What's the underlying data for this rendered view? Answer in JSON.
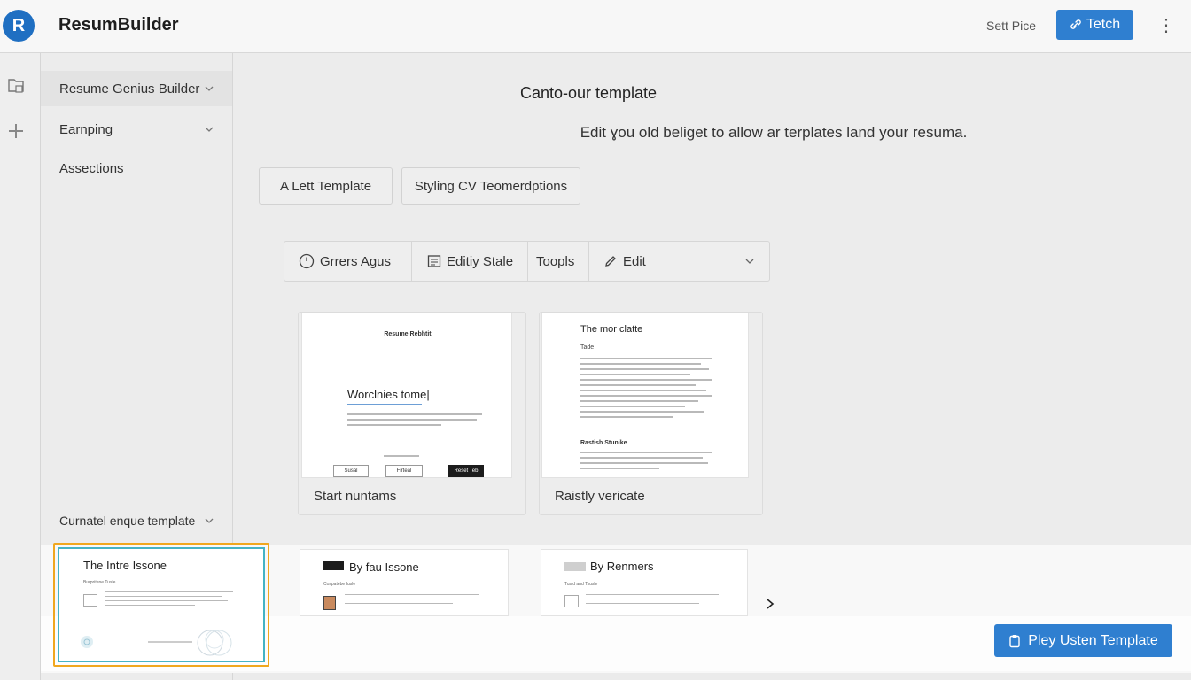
{
  "header": {
    "logo_letter": "R",
    "app_title": "ResumBuilder",
    "link_label": "Sett Pice",
    "action_button_label": "Tetch",
    "brand_color": "#2f7fd0"
  },
  "rail": {
    "icons": [
      "folder-icon",
      "plus-icon"
    ]
  },
  "sidebar": {
    "items": [
      {
        "label": "Resume Genius Builder",
        "has_dropdown": true
      },
      {
        "label": "Earnping",
        "has_dropdown": true
      },
      {
        "label": "Assections",
        "has_dropdown": false
      }
    ],
    "bottom_item": {
      "label": "Curnatel enque template",
      "has_dropdown": true
    }
  },
  "main": {
    "title": "Canto-our template",
    "subtitle": "Edit ɣou old beliget to allow ar terplates land your resuma.",
    "chips": [
      "A Lett Template",
      "Styling CV Teomerdptions"
    ],
    "toolbar": [
      {
        "label": "Grrers Agus",
        "icon": "clock-icon"
      },
      {
        "label": "Editiy Stale",
        "icon": "document-icon"
      },
      {
        "label": "Toopls",
        "icon": ""
      },
      {
        "label": "Edit",
        "icon": "pencil-icon",
        "has_dropdown": true
      }
    ],
    "cards": [
      {
        "label": "Start nuntams",
        "preview": {
          "header": "Resume Rebhtit",
          "heading": "Worclnies tome|",
          "buttons": [
            "Susal",
            "Firteal",
            "Reset Teb"
          ]
        }
      },
      {
        "label": "Raistly vericate",
        "preview": {
          "heading": "The mor clatte",
          "subheading": "Tade",
          "section_heading": "Rastish Stunike"
        }
      }
    ]
  },
  "template_strip": {
    "thumbs": [
      {
        "title": "The Intre Issone",
        "subtitle": "Burpritene Tusle",
        "selected": true
      },
      {
        "title": "By fau Issone",
        "subtitle": "Cospatebe Iusle",
        "selected": false
      },
      {
        "title": "By Renmers",
        "subtitle": "Tusid and Tsusle",
        "selected": false
      }
    ],
    "next_icon": "chevron-right-icon",
    "cta_label": "Pley Usten Template",
    "selection_color": "#f0a71e",
    "selection_inner_color": "#45b3c4"
  }
}
